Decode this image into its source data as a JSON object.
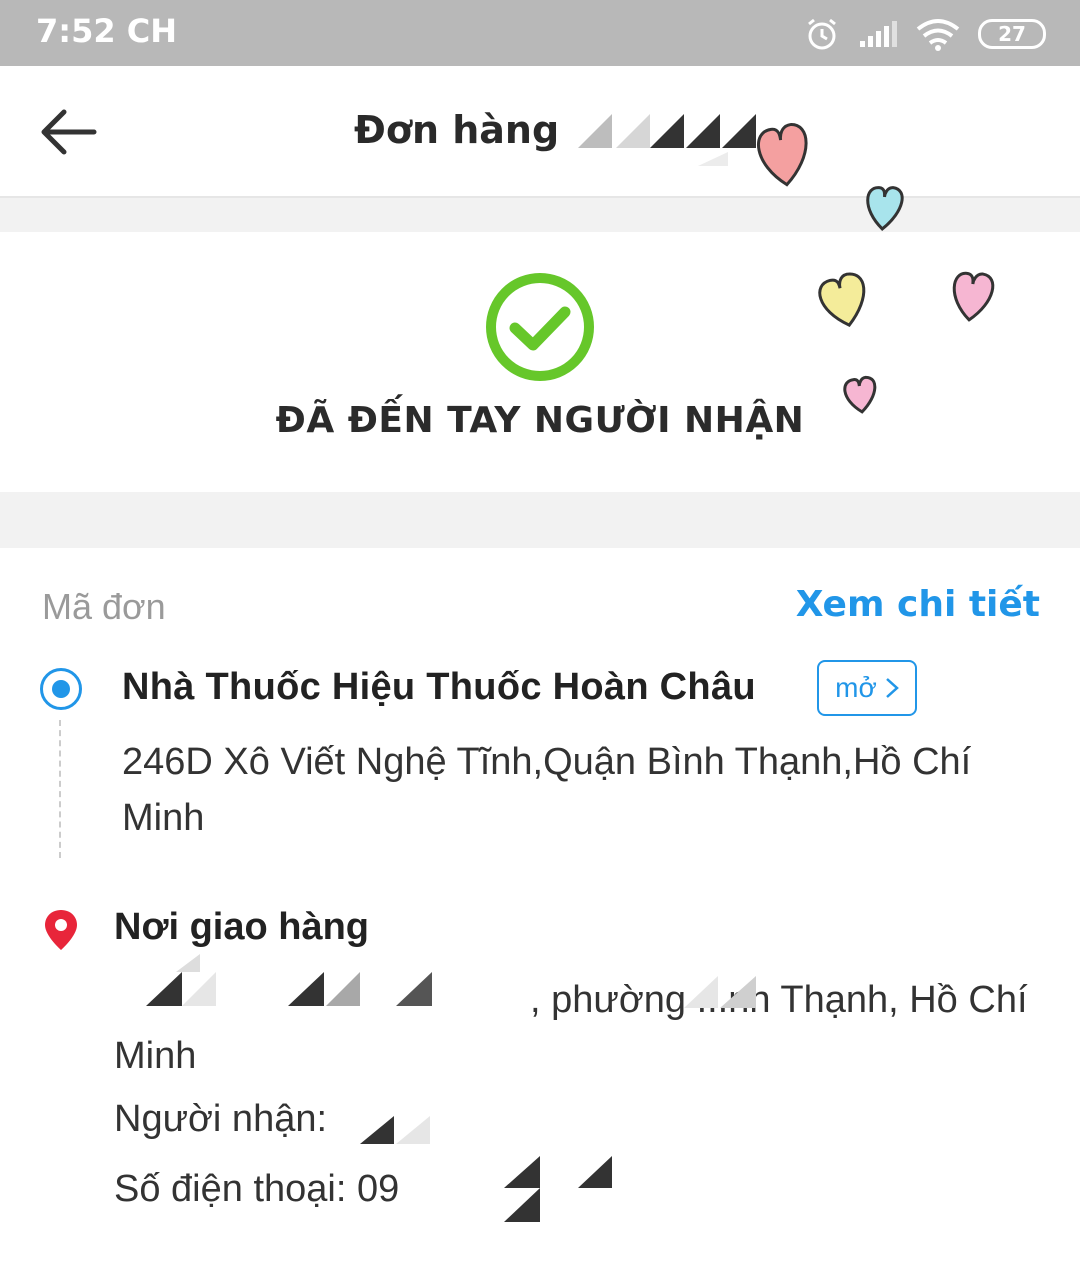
{
  "status_bar": {
    "time": "7:52 CH",
    "battery": "27"
  },
  "header": {
    "title": "Đơn hàng"
  },
  "order_status": {
    "text": "ĐÃ ĐẾN TAY NGƯỜI NHẬN"
  },
  "order": {
    "code_label": "Mã đơn",
    "detail_link": "Xem chi tiết",
    "store": {
      "name": "Nhà Thuốc Hiệu Thuốc Hoàn Châu",
      "open_label": "mở",
      "address": "246D Xô Viết Nghệ Tĩnh,Quận Bình Thạnh,Hồ Chí Minh"
    },
    "delivery": {
      "label": "Nơi giao hàng",
      "address": ", phường ...nh Thạnh, Hồ Chí Minh",
      "receiver": "Người nhận: ",
      "phone": "Số điện thoại: 09"
    }
  },
  "colors": {
    "accent": "#2196e8",
    "success": "#66c72a",
    "pin": "#e8253a"
  }
}
